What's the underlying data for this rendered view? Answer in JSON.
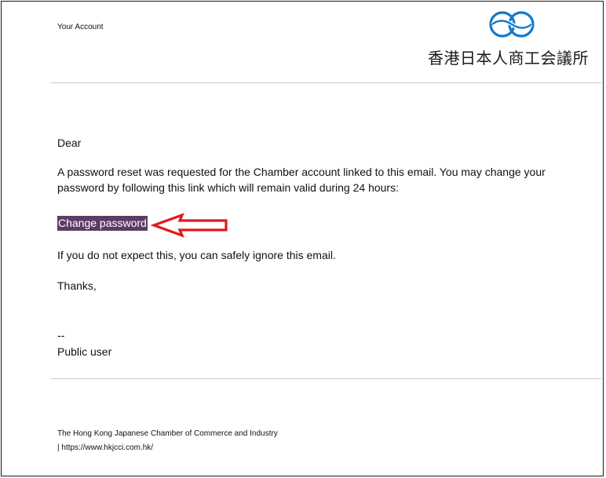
{
  "header": {
    "account_label": "Your Account",
    "logo_text": "香港日本人商工会議所",
    "logo_icon": "hkjcci-wave-logo-icon"
  },
  "email": {
    "greeting": "Dear",
    "paragraph": "A password reset was requested for the Chamber account linked to this email. You may change your password by following this link which will remain valid during 24 hours:",
    "link_label": "Change password",
    "ignore_text": "If you do not expect this, you can safely ignore this email.",
    "thanks": "Thanks,",
    "signature_dashes": "--",
    "signature_name": "Public user"
  },
  "footer": {
    "organization": "The Hong Kong Japanese Chamber of Commerce and Industry",
    "url_line": "| https://www.hkjcci.com.hk/"
  },
  "annotation": {
    "arrow_icon": "red-arrow-left-icon",
    "arrow_color": "#e0191d"
  },
  "colors": {
    "link_highlight": "#5c3b66",
    "logo_blue": "#1479c9",
    "divider": "#c9c9c9"
  }
}
